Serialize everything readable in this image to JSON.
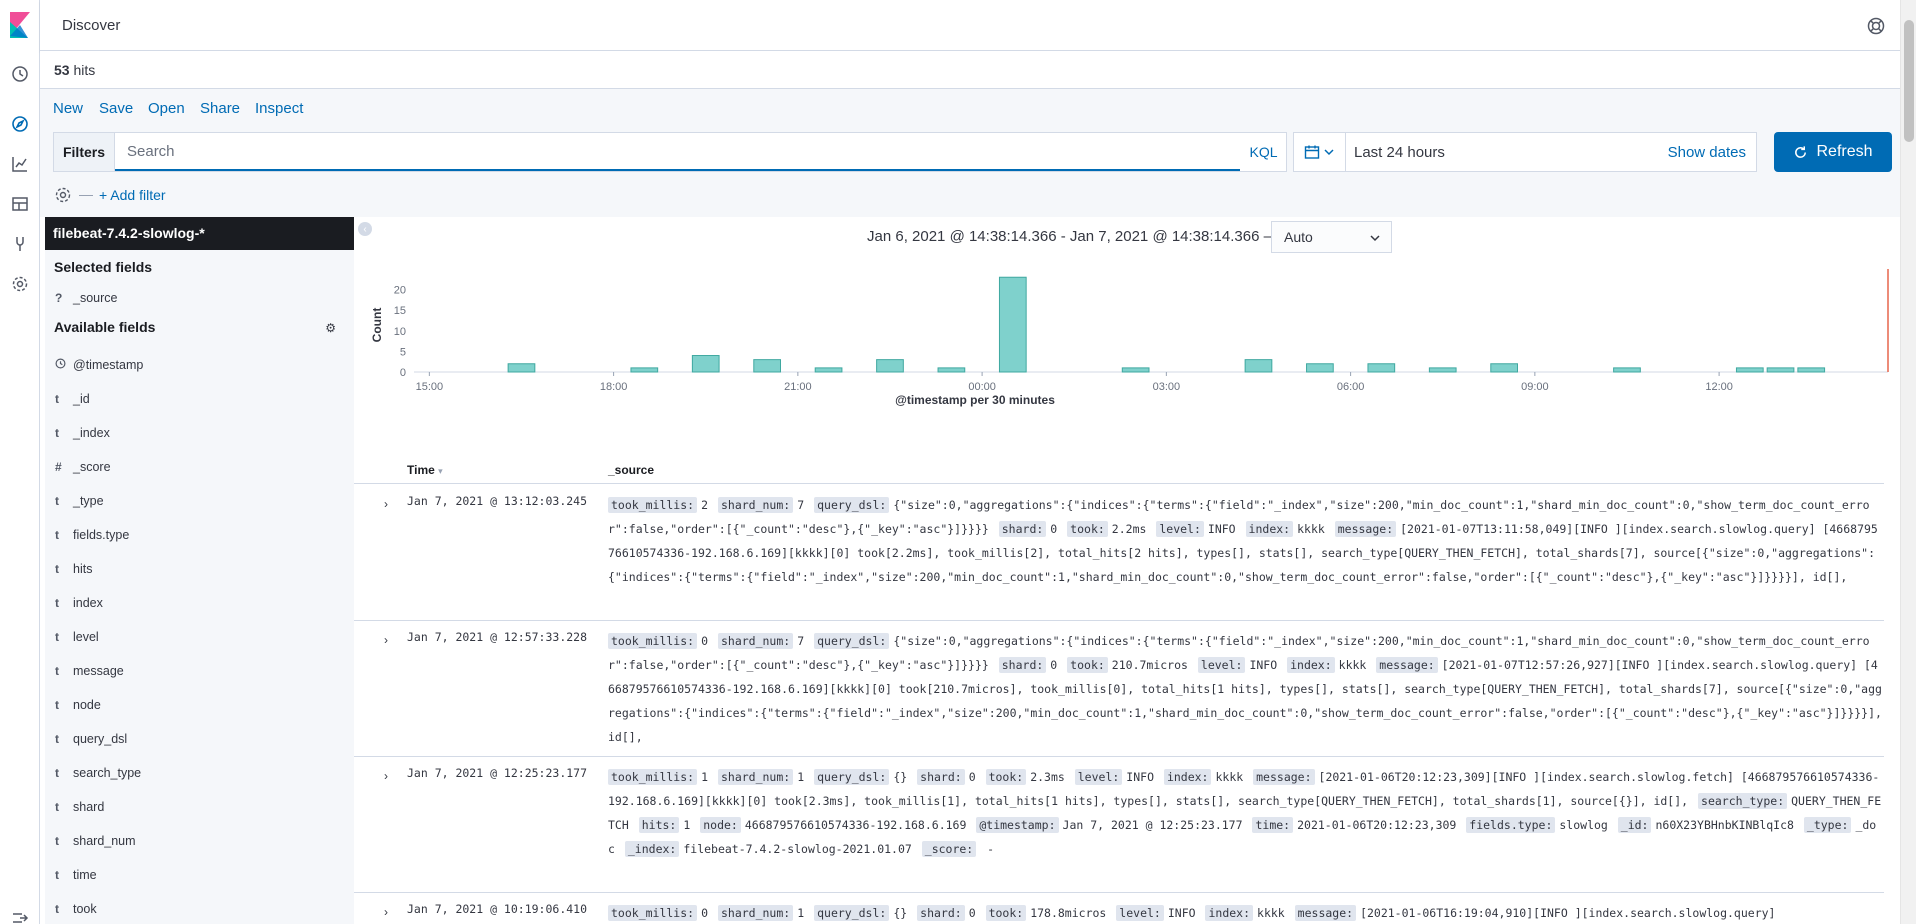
{
  "app": {
    "title": "Discover",
    "hits_count": "53",
    "hits_label": "hits"
  },
  "topmenu": {
    "items": [
      "New",
      "Save",
      "Open",
      "Share",
      "Inspect"
    ]
  },
  "query": {
    "filters_label": "Filters",
    "placeholder": "Search",
    "language": "KQL"
  },
  "timepicker": {
    "range_label": "Last 24 hours",
    "show_dates": "Show dates",
    "refresh_label": "Refresh"
  },
  "filterbar": {
    "add_filter": "+ Add filter"
  },
  "sidebar": {
    "index_pattern": "filebeat-7.4.2-slowlog-*",
    "selected_heading": "Selected fields",
    "selected_fields": [
      {
        "type": "?",
        "name": "_source"
      }
    ],
    "available_heading": "Available fields",
    "available_fields": [
      {
        "type": "clock",
        "name": "@timestamp"
      },
      {
        "type": "t",
        "name": "_id"
      },
      {
        "type": "t",
        "name": "_index"
      },
      {
        "type": "#",
        "name": "_score"
      },
      {
        "type": "t",
        "name": "_type"
      },
      {
        "type": "t",
        "name": "fields.type"
      },
      {
        "type": "t",
        "name": "hits"
      },
      {
        "type": "t",
        "name": "index"
      },
      {
        "type": "t",
        "name": "level"
      },
      {
        "type": "t",
        "name": "message"
      },
      {
        "type": "t",
        "name": "node"
      },
      {
        "type": "t",
        "name": "query_dsl"
      },
      {
        "type": "t",
        "name": "search_type"
      },
      {
        "type": "t",
        "name": "shard"
      },
      {
        "type": "t",
        "name": "shard_num"
      },
      {
        "type": "t",
        "name": "time"
      },
      {
        "type": "t",
        "name": "took"
      }
    ]
  },
  "histogram_header": {
    "time_range": "Jan 6, 2021 @ 14:38:14.366 - Jan 7, 2021 @ 14:38:14.366 —",
    "interval": "Auto"
  },
  "chart_data": {
    "type": "bar",
    "title": "",
    "xlabel": "@timestamp per 30 minutes",
    "ylabel": "Count",
    "ylim": [
      0,
      25
    ],
    "y_ticks": [
      "0",
      "5",
      "10",
      "15",
      "20"
    ],
    "x_ticks": [
      "15:00",
      "18:00",
      "21:00",
      "00:00",
      "03:00",
      "06:00",
      "09:00",
      "12:00"
    ],
    "bars": [
      {
        "slot": 3,
        "value": 2
      },
      {
        "slot": 7,
        "value": 1
      },
      {
        "slot": 9,
        "value": 4
      },
      {
        "slot": 11,
        "value": 3
      },
      {
        "slot": 13,
        "value": 1
      },
      {
        "slot": 15,
        "value": 3
      },
      {
        "slot": 17,
        "value": 1
      },
      {
        "slot": 19,
        "value": 23
      },
      {
        "slot": 23,
        "value": 1
      },
      {
        "slot": 27,
        "value": 3
      },
      {
        "slot": 29,
        "value": 2
      },
      {
        "slot": 31,
        "value": 2
      },
      {
        "slot": 33,
        "value": 1
      },
      {
        "slot": 35,
        "value": 2
      },
      {
        "slot": 39,
        "value": 1
      },
      {
        "slot": 43,
        "value": 1
      },
      {
        "slot": 44,
        "value": 1
      },
      {
        "slot": 45,
        "value": 1
      }
    ],
    "bar_color": "#7fd1cc",
    "bar_stroke": "#3fa8a0",
    "now_line_color": "#e7664c",
    "grid": false
  },
  "table": {
    "headers": {
      "time": "Time",
      "source": "_source"
    },
    "rows": [
      {
        "time": "Jan 7, 2021 @ 13:12:03.245",
        "fields": [
          {
            "k": "took_millis:",
            "v": "2"
          },
          {
            "k": "shard_num:",
            "v": "7"
          },
          {
            "k": "query_dsl:",
            "v": "{\"size\":0,\"aggregations\":{\"indices\":{\"terms\":{\"field\":\"_index\",\"size\":200,\"min_doc_count\":1,\"shard_min_doc_count\":0,\"show_term_doc_count_error\":false,\"order\":[{\"_count\":\"desc\"},{\"_key\":\"asc\"}]}}}}"
          },
          {
            "k": "shard:",
            "v": "0"
          },
          {
            "k": "took:",
            "v": "2.2ms"
          },
          {
            "k": "level:",
            "v": "INFO"
          },
          {
            "k": "index:",
            "v": "kkkk"
          },
          {
            "k": "message:",
            "v": "[2021-01-07T13:11:58,049][INFO ][index.search.slowlog.query] [466879576610574336-192.168.6.169][kkkk][0] took[2.2ms], took_millis[2], total_hits[2 hits], types[], stats[], search_type[QUERY_THEN_FETCH], total_shards[7], source[{\"size\":0,\"aggregations\":{\"indices\":{\"terms\":{\"field\":\"_index\",\"size\":200,\"min_doc_count\":1,\"shard_min_doc_count\":0,\"show_term_doc_count_error\":false,\"order\":[{\"_count\":\"desc\"},{\"_key\":\"asc\"}]}}}}], id[],"
          }
        ]
      },
      {
        "time": "Jan 7, 2021 @ 12:57:33.228",
        "fields": [
          {
            "k": "took_millis:",
            "v": "0"
          },
          {
            "k": "shard_num:",
            "v": "7"
          },
          {
            "k": "query_dsl:",
            "v": "{\"size\":0,\"aggregations\":{\"indices\":{\"terms\":{\"field\":\"_index\",\"size\":200,\"min_doc_count\":1,\"shard_min_doc_count\":0,\"show_term_doc_count_error\":false,\"order\":[{\"_count\":\"desc\"},{\"_key\":\"asc\"}]}}}}"
          },
          {
            "k": "shard:",
            "v": "0"
          },
          {
            "k": "took:",
            "v": "210.7micros"
          },
          {
            "k": "level:",
            "v": "INFO"
          },
          {
            "k": "index:",
            "v": "kkkk"
          },
          {
            "k": "message:",
            "v": "[2021-01-07T12:57:26,927][INFO ][index.search.slowlog.query] [466879576610574336-192.168.6.169][kkkk][0] took[210.7micros], took_millis[0], total_hits[1 hits], types[], stats[], search_type[QUERY_THEN_FETCH], total_shards[7], source[{\"size\":0,\"aggregations\":{\"indices\":{\"terms\":{\"field\":\"_index\",\"size\":200,\"min_doc_count\":1,\"shard_min_doc_count\":0,\"show_term_doc_count_error\":false,\"order\":[{\"_count\":\"desc\"},{\"_key\":\"asc\"}]}}}}], id[],"
          }
        ]
      },
      {
        "time": "Jan 7, 2021 @ 12:25:23.177",
        "fields": [
          {
            "k": "took_millis:",
            "v": "1"
          },
          {
            "k": "shard_num:",
            "v": "1"
          },
          {
            "k": "query_dsl:",
            "v": "{}"
          },
          {
            "k": "shard:",
            "v": "0"
          },
          {
            "k": "took:",
            "v": "2.3ms"
          },
          {
            "k": "level:",
            "v": "INFO"
          },
          {
            "k": "index:",
            "v": "kkkk"
          },
          {
            "k": "message:",
            "v": "[2021-01-06T20:12:23,309][INFO ][index.search.slowlog.fetch] [466879576610574336-192.168.6.169][kkkk][0] took[2.3ms], took_millis[1], total_hits[1 hits], types[], stats[], search_type[QUERY_THEN_FETCH], total_shards[1], source[{}], id[],"
          },
          {
            "k": "search_type:",
            "v": "QUERY_THEN_FETCH"
          },
          {
            "k": "hits:",
            "v": "1"
          },
          {
            "k": "node:",
            "v": "466879576610574336-192.168.6.169"
          },
          {
            "k": "@timestamp:",
            "v": "Jan 7, 2021 @ 12:25:23.177"
          },
          {
            "k": "time:",
            "v": "2021-01-06T20:12:23,309"
          },
          {
            "k": "fields.type:",
            "v": "slowlog"
          },
          {
            "k": "_id:",
            "v": "n60X23YBHnbKINBlqIc8"
          },
          {
            "k": "_type:",
            "v": "_doc"
          },
          {
            "k": "_index:",
            "v": "filebeat-7.4.2-slowlog-2021.01.07"
          },
          {
            "k": "_score:",
            "v": " -"
          }
        ]
      },
      {
        "time": "Jan 7, 2021 @ 10:19:06.410",
        "fields": [
          {
            "k": "took_millis:",
            "v": "0"
          },
          {
            "k": "shard_num:",
            "v": "1"
          },
          {
            "k": "query_dsl:",
            "v": "{}"
          },
          {
            "k": "shard:",
            "v": "0"
          },
          {
            "k": "took:",
            "v": "178.8micros"
          },
          {
            "k": "level:",
            "v": "INFO"
          },
          {
            "k": "index:",
            "v": "kkkk"
          },
          {
            "k": "message:",
            "v": "[2021-01-06T16:19:04,910][INFO ][index.search.slowlog.query]"
          }
        ]
      }
    ]
  },
  "colors": {
    "accent": "#006bb4",
    "index_bg": "#1a1c21",
    "sidebar_bg": "#f5f7fa"
  }
}
